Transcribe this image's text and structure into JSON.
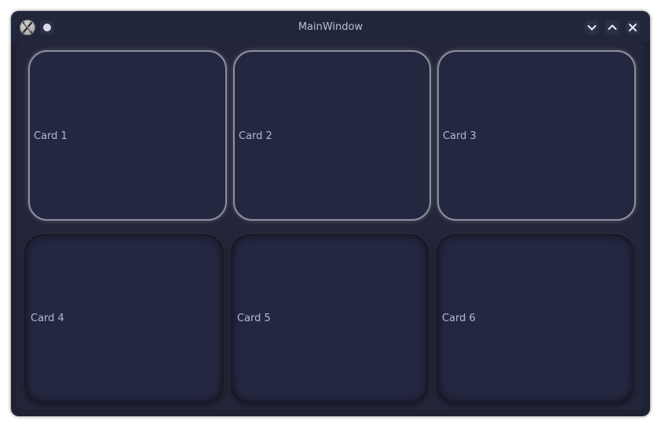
{
  "window": {
    "title": "MainWindow",
    "icons": {
      "app": "x-window-system-icon",
      "pin": "pin-dot-icon",
      "minimize": "chevron-down-icon",
      "maximize": "chevron-up-icon",
      "close": "close-icon"
    }
  },
  "cards": [
    {
      "label": "Card 1",
      "style": "raised"
    },
    {
      "label": "Card 2",
      "style": "raised"
    },
    {
      "label": "Card 3",
      "style": "raised"
    },
    {
      "label": "Card 4",
      "style": "sunken"
    },
    {
      "label": "Card 5",
      "style": "sunken"
    },
    {
      "label": "Card 6",
      "style": "sunken"
    }
  ],
  "colors": {
    "window_bg": "#1e2132",
    "card_bg": "#242740",
    "text": "#b3bad2",
    "raised_border": "#8d8f9c"
  }
}
